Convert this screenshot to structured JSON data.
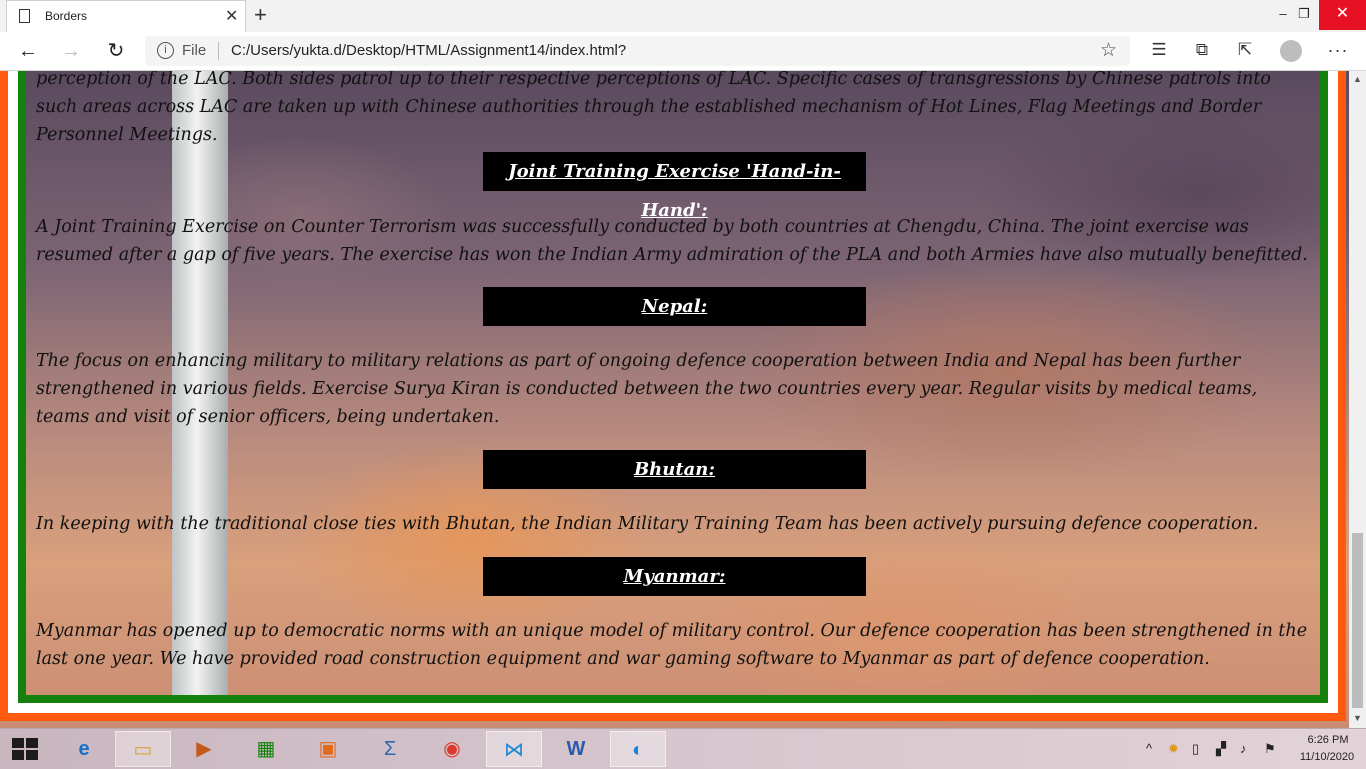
{
  "tab": {
    "title": "Borders",
    "close": "✕",
    "new": "+"
  },
  "window": {
    "minimize": "–",
    "maximize": "❐",
    "close": "✕"
  },
  "address": {
    "protocol_label": "File",
    "url": "C:/Users/yukta.d/Desktop/HTML/Assignment14/index.html?"
  },
  "page": {
    "partial_text": "perception of the LAC. Both sides patrol up to their respective perceptions of LAC. Specific cases of transgressions by Chinese patrols into such areas across LAC are taken up with Chinese authorities through the established mechanism of Hot Lines, Flag Meetings and Border Personnel Meetings.",
    "sections": [
      {
        "heading": "Joint Training Exercise 'Hand-in-Hand':",
        "text": "A Joint Training Exercise on Counter Terrorism was successfully conducted by both countries at Chengdu, China. The joint exercise was resumed after a gap of five years. The exercise has won the Indian Army admiration of the PLA and both Armies have also mutually benefitted."
      },
      {
        "heading": "Nepal:",
        "text": "The focus on enhancing military to military relations as part of ongoing defence cooperation between India and Nepal has been further strengthened in various fields. Exercise Surya Kiran is conducted between the two countries every year. Regular visits by medical teams, teams and visit of senior officers, being undertaken."
      },
      {
        "heading": "Bhutan:",
        "text": "In keeping with the traditional close ties with Bhutan, the Indian Military Training Team has been actively pursuing defence cooperation."
      },
      {
        "heading": "Myanmar:",
        "text": "Myanmar has opened up to democratic norms with an unique model of military control. Our defence cooperation has been strengthened in the last one year. We have provided road construction equipment and war gaming software to Myanmar as part of defence cooperation."
      }
    ]
  },
  "colors": {
    "border_outer": "#ff5a10",
    "border_middle": "#ffffff",
    "border_inner": "#13810b",
    "heading_bg": "#000000"
  },
  "taskbar": {
    "apps": [
      "internet-explorer",
      "file-explorer",
      "media-player",
      "store",
      "office",
      "math-input",
      "chrome",
      "vscode",
      "word",
      "edge"
    ],
    "time": "6:26 PM",
    "date": "11/10/2020"
  }
}
